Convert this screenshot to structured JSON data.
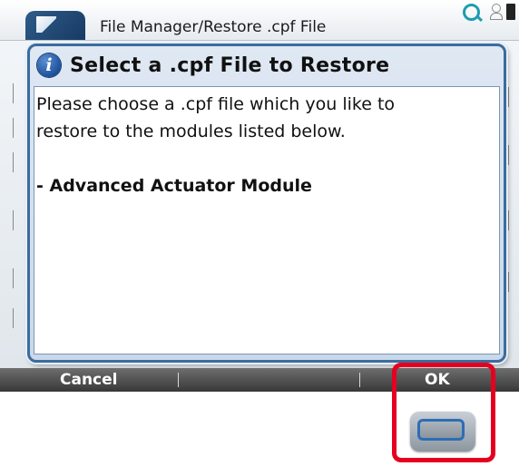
{
  "window": {
    "title": "File Manager/Restore .cpf File"
  },
  "status_icons": [
    "search-icon",
    "user-icon",
    "battery-icon"
  ],
  "dialog": {
    "icon": "info-icon",
    "title": "Select a .cpf File to Restore",
    "message_line1": "Please choose a .cpf file which you like to",
    "message_line2": "restore to the modules listed below.",
    "module_item": "- Advanced Actuator Module"
  },
  "softkeys": {
    "cancel_label": "Cancel",
    "ok_label": "OK"
  },
  "colors": {
    "dialog_border": "#3b6c9e",
    "softkey_bar": "#4a4a4a",
    "highlight": "#e6001f",
    "hw_key_ring": "#2d6eb5"
  }
}
